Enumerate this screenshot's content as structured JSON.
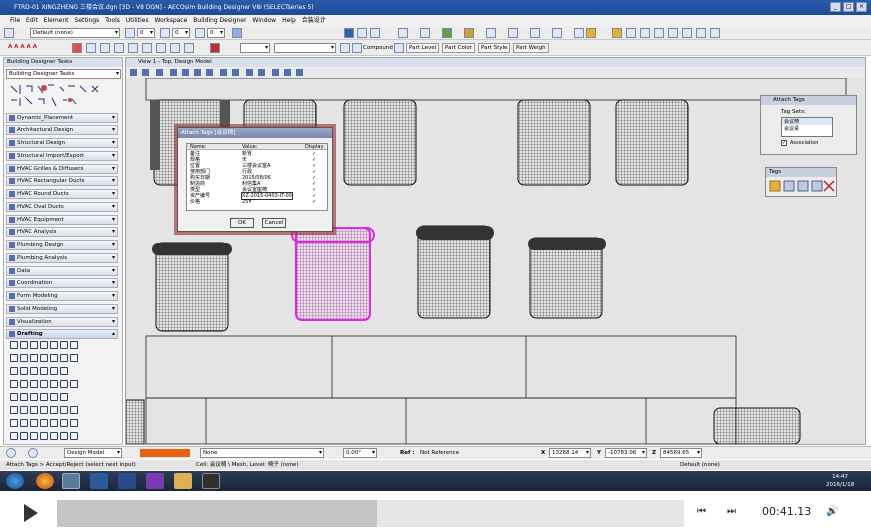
{
  "window": {
    "title": "FTRD-01 XINGZHENG 三楼会议.dgn [3D - V8 DGN] - AECOsim Building Designer V8i (SELECTseries 5)"
  },
  "menu": [
    "File",
    "Edit",
    "Element",
    "Settings",
    "Tools",
    "Utilities",
    "Workspace",
    "Building Designer",
    "Window",
    "Help",
    "合装设计"
  ],
  "toolbar1": {
    "level": "Default (none)",
    "value1": "0",
    "value2": "0",
    "value3": "0"
  },
  "toolbar2": {
    "compound_label": "Compound",
    "part_level": "Part Level",
    "part_color": "Part Color",
    "part_style": "Part Style",
    "part_weight": "Part Weigh"
  },
  "left_panel": {
    "title": "Building Designer Tasks",
    "selector": "Building Designer Tasks",
    "categories": [
      "Dynamic_Placement",
      "Architectural Design",
      "Structural Design",
      "Structural Import/Export",
      "HVAC Grilles & Diffusers",
      "HVAC Rectangular Ducts",
      "HVAC Round Ducts",
      "HVAC Oval Ducts",
      "HVAC Equipment",
      "HVAC Analysis",
      "Plumbing Design",
      "Plumbing Analysis",
      "Data",
      "Coordination",
      "Form Modeling",
      "Solid Modeling",
      "Visualization",
      "Drafting"
    ]
  },
  "view": {
    "title": "View 1 - Top, Design Model"
  },
  "dialog": {
    "title": "Attach Tags [会议椅]",
    "columns": [
      "Name:",
      "Value:",
      "Display"
    ],
    "rows": [
      [
        "备注",
        "新胃",
        "✓"
      ],
      [
        "规格",
        "无",
        "✓"
      ],
      [
        "位置",
        "三楼会议室A",
        "✓"
      ],
      [
        "使用部门",
        "行政",
        "✓"
      ],
      [
        "购买日期",
        "2015/08/06",
        "✓"
      ],
      [
        "制造商",
        "利信集A",
        "✓"
      ],
      [
        "类型",
        "会议室座椅",
        "✓"
      ],
      [
        "资产编号",
        "XZ-2015-0403-IT-00",
        "✓"
      ],
      [
        "价格",
        "25¥",
        "✓"
      ]
    ],
    "ok": "OK",
    "cancel": "Cancel"
  },
  "attach_panel": {
    "title": "Attach Tags",
    "tag_sets_label": "Tag Sets:",
    "items": [
      "会议椅",
      "会议桌"
    ],
    "association": "Association"
  },
  "tags_panel": {
    "title": "Tags"
  },
  "bottom_toolbar": {
    "model": "Design Model",
    "level": "None",
    "angle": "0.00°",
    "ref_label": "Ref :",
    "ref_value": "Not Reference",
    "x_label": "X",
    "x": "13268.14",
    "y_label": "Y",
    "y": "-10783.06",
    "z_label": "Z",
    "z": "84569.65"
  },
  "status": {
    "left": "Attach Tags > Accept/Reject (select next input)",
    "middle": "Cell: 会议椅 \\ Mesh, Level: 椅子 (none)",
    "right": "Default (none)"
  },
  "clock": {
    "time": "14:47",
    "date": "2016/1/18"
  },
  "player": {
    "timecode": "00:41.13",
    "progress": 0.51
  },
  "colors": {
    "accent": "#2a5caa",
    "highlight": "#e028e0"
  }
}
